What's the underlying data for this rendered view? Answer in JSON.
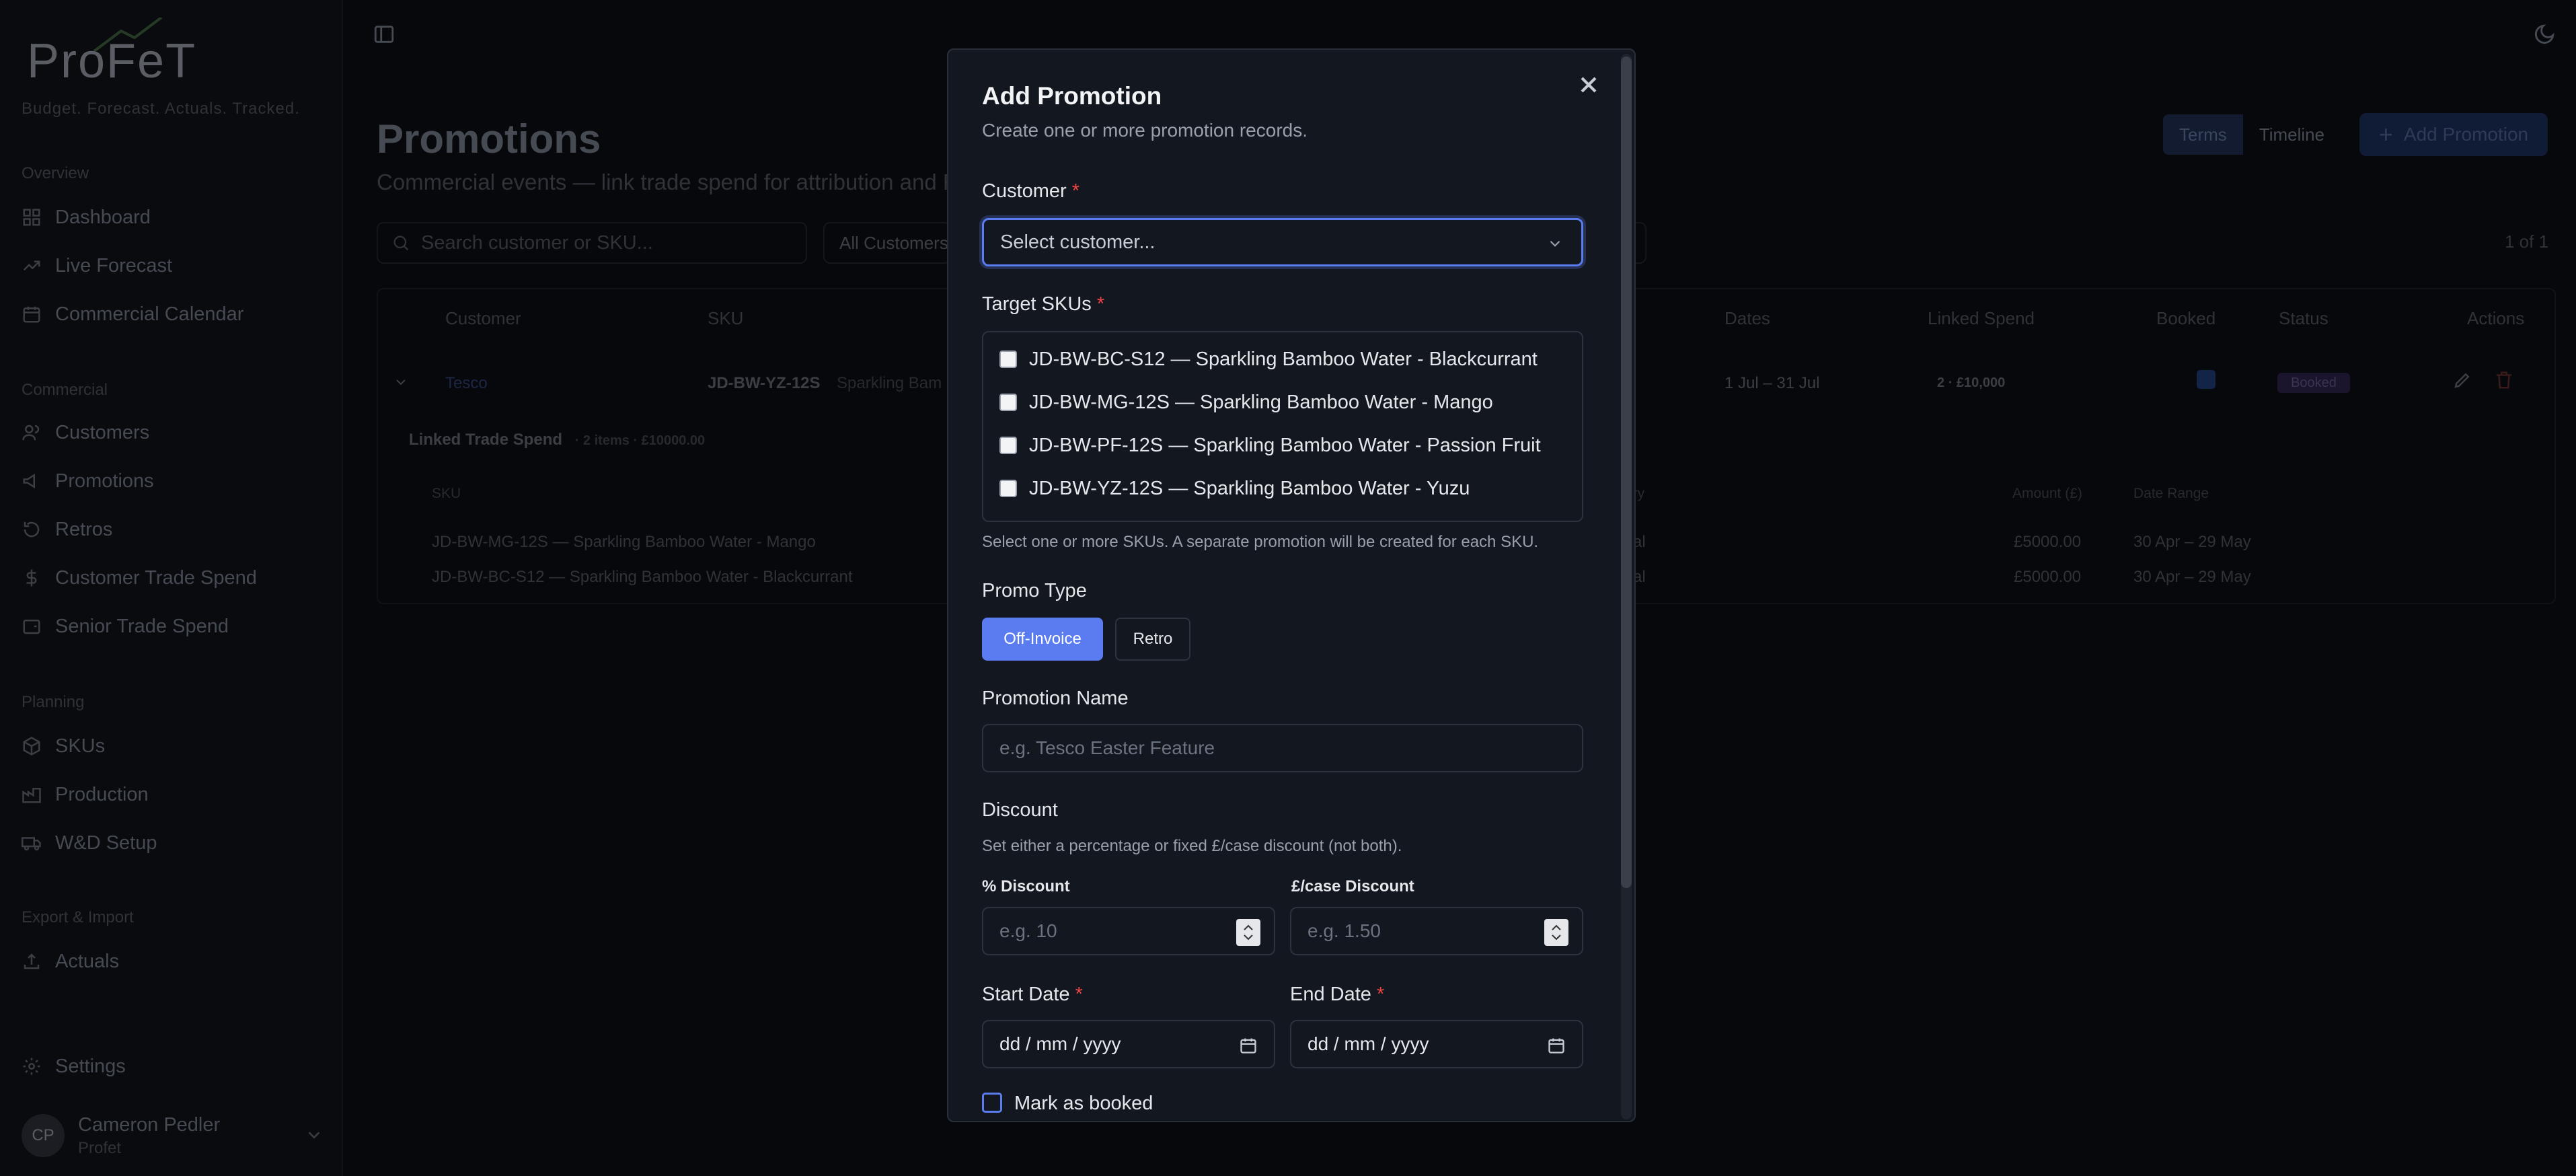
{
  "app": {
    "logo": "ProFeT",
    "tagline": "Budget. Forecast. Actuals. Tracked."
  },
  "sidebar": {
    "sections": [
      {
        "title": "Overview",
        "items": [
          "Dashboard",
          "Live Forecast",
          "Commercial Calendar"
        ]
      },
      {
        "title": "Commercial",
        "items": [
          "Customers",
          "Promotions",
          "Retros",
          "Customer Trade Spend",
          "Senior Trade Spend"
        ]
      },
      {
        "title": "Planning",
        "items": [
          "SKUs",
          "Production",
          "W&D Setup"
        ]
      },
      {
        "title": "Export & Import",
        "items": [
          "Actuals"
        ]
      }
    ],
    "settings": "Settings",
    "user": {
      "initials": "CP",
      "name": "Cameron Pedler",
      "org": "Profet"
    }
  },
  "page": {
    "title": "Promotions",
    "subtitle": "Commercial events — link trade spend for attribution and P",
    "view_terms": "Terms",
    "view_timeline": "Timeline",
    "add_button": "Add Promotion",
    "search_placeholder": "Search customer or SKU...",
    "filter_customer": "All Customers",
    "count": "1 of 1",
    "columns": {
      "customer": "Customer",
      "sku": "SKU",
      "dates": "Dates",
      "linked_spend": "Linked Spend",
      "booked": "Booked",
      "status": "Status",
      "actions": "Actions"
    },
    "row": {
      "customer": "Tesco",
      "sku": "JD-BW-YZ-12S",
      "sku_desc": "Sparkling Bam",
      "dates": "1 Jul – 31 Jul",
      "linked_spend": "2 · £10,000",
      "status": "Booked"
    },
    "linked": {
      "title": "Linked Trade Spend",
      "summary": "· 2 items · £10000.00",
      "columns": {
        "sku": "SKU",
        "category": "ory",
        "amount": "Amount (£)",
        "range": "Date Range"
      },
      "rows": [
        {
          "sku": "JD-BW-MG-12S — Sparkling Bamboo Water - Mango",
          "cat": "al",
          "amount": "£5000.00",
          "range": "30 Apr – 29 May"
        },
        {
          "sku": "JD-BW-BC-S12 — Sparkling Bamboo Water - Blackcurrant",
          "cat": "al",
          "amount": "£5000.00",
          "range": "30 Apr – 29 May"
        }
      ]
    }
  },
  "modal": {
    "title": "Add Promotion",
    "subtitle": "Create one or more promotion records.",
    "customer_label": "Customer",
    "customer_placeholder": "Select customer...",
    "skus_label": "Target SKUs",
    "skus": [
      "JD-BW-BC-S12 — Sparkling Bamboo Water - Blackcurrant",
      "JD-BW-MG-12S — Sparkling Bamboo Water - Mango",
      "JD-BW-PF-12S — Sparkling Bamboo Water - Passion Fruit",
      "JD-BW-YZ-12S — Sparkling Bamboo Water - Yuzu"
    ],
    "skus_help": "Select one or more SKUs. A separate promotion will be created for each SKU.",
    "promo_type_label": "Promo Type",
    "promo_types": [
      "Off-Invoice",
      "Retro"
    ],
    "promo_type_selected": "Off-Invoice",
    "name_label": "Promotion Name",
    "name_placeholder": "e.g. Tesco Easter Feature",
    "discount_label": "Discount",
    "discount_help": "Set either a percentage or fixed £/case discount (not both).",
    "pct_label": "% Discount",
    "pct_placeholder": "e.g. 10",
    "case_label": "£/case Discount",
    "case_placeholder": "e.g. 1.50",
    "start_label": "Start Date",
    "end_label": "End Date",
    "date_placeholder": "dd / mm / yyyy",
    "booked_label": "Mark as booked"
  }
}
